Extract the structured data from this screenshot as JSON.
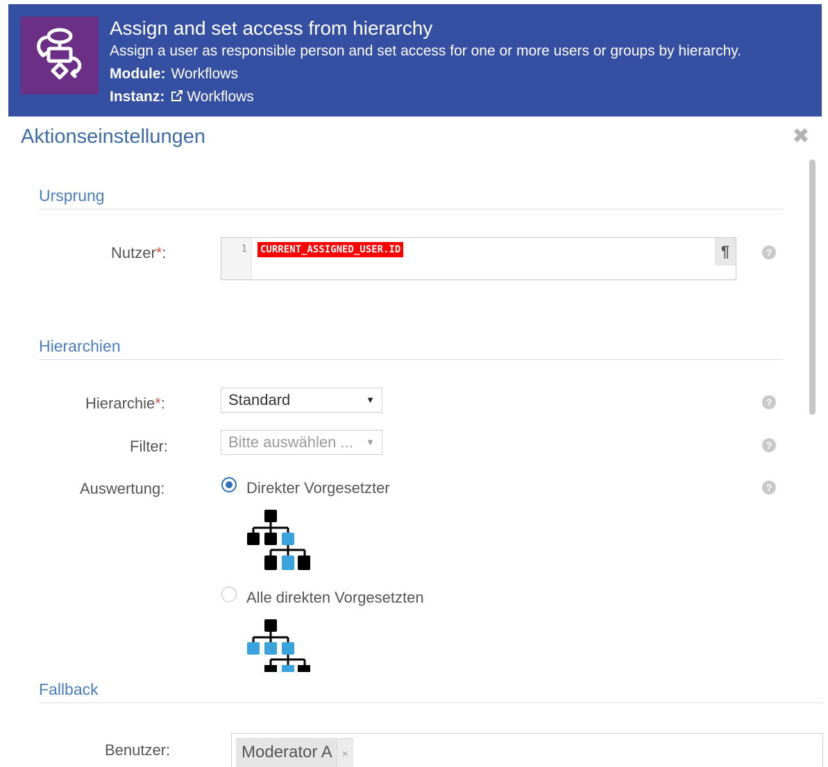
{
  "banner": {
    "title": "Assign and set access from hierarchy",
    "description": "Assign a user as responsible person and set access for one or more users or groups by hierarchy.",
    "module_label": "Module:",
    "module_value": "Workflows",
    "instanz_label": "Instanz:",
    "instanz_value": "Workflows",
    "icon": "workflow-icon",
    "background_color": "#354fa3",
    "icon_background_color": "#6b2f86"
  },
  "modal": {
    "title": "Aktionseinstellungen",
    "close_icon": "close-icon"
  },
  "ursprung": {
    "section_title": "Ursprung",
    "nutzer_label": "Nutzer",
    "required_mark": "*",
    "label_suffix": ":",
    "code_line_number": "1",
    "code_value": "CURRENT_ASSIGNED_USER.ID",
    "pilcrow": "¶"
  },
  "hierarchien": {
    "section_title": "Hierarchien",
    "hierarchie_label": "Hierarchie",
    "hierarchie_value": "Standard",
    "filter_label": "Filter:",
    "filter_placeholder": "Bitte auswählen ...",
    "auswertung_label": "Auswertung:",
    "options": [
      {
        "label": "Direkter Vorgesetzter",
        "checked": true
      },
      {
        "label": "Alle direkten Vorgesetzten",
        "checked": false
      }
    ]
  },
  "fallback": {
    "section_title": "Fallback",
    "benutzer_label": "Benutzer:",
    "tags": [
      "Moderator A"
    ],
    "tag_remove": "×"
  },
  "help_icon": "?",
  "colors": {
    "accent": "#4b7cc0",
    "token_background": "#ff0000",
    "hierarchy_highlight": "#3aa3dc"
  }
}
